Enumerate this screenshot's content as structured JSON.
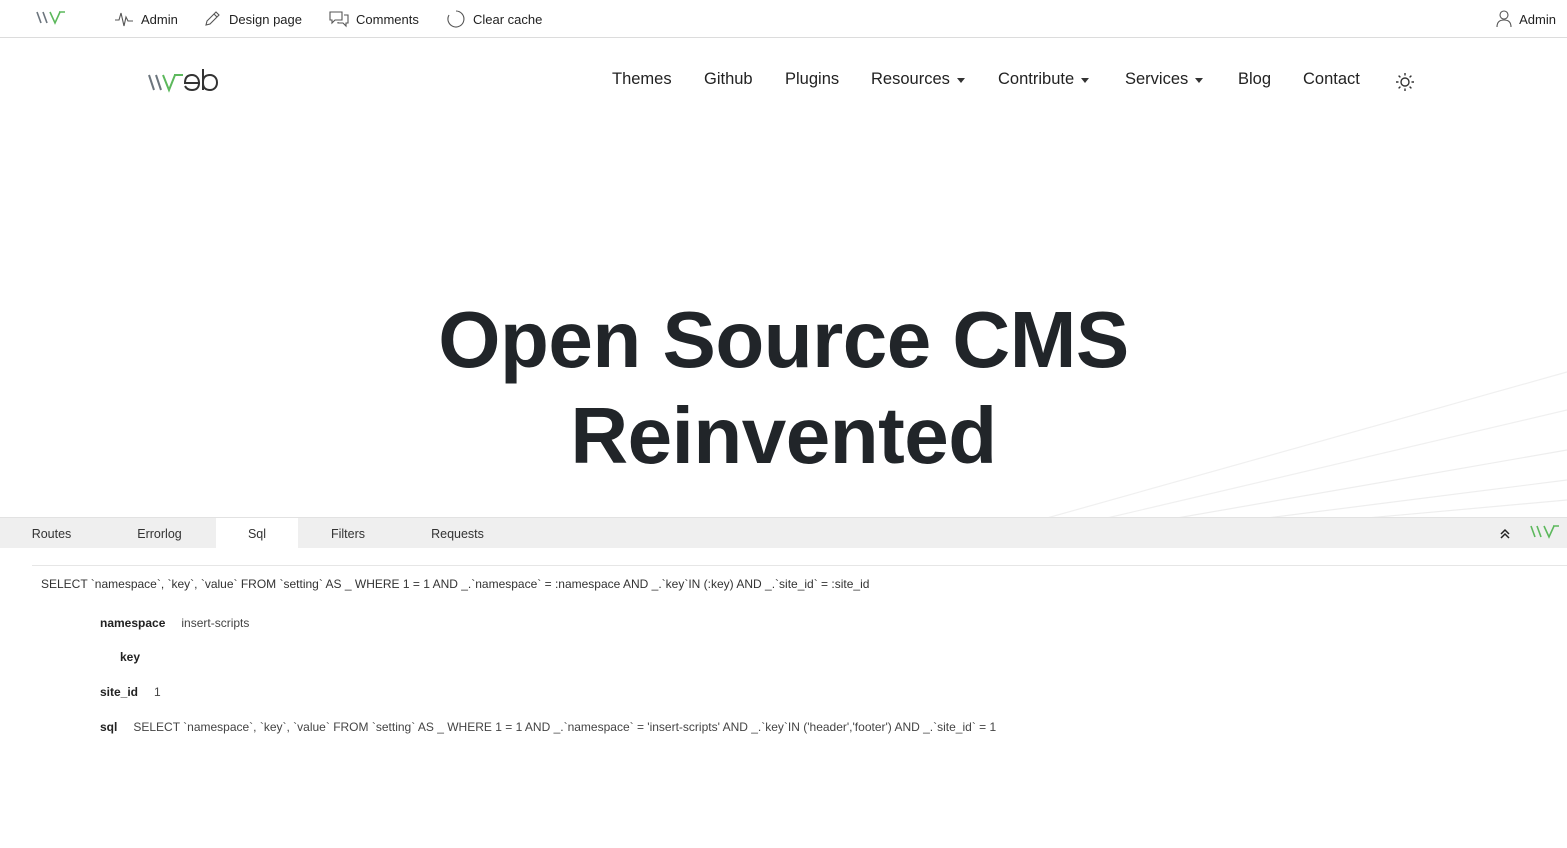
{
  "adminbar": {
    "items": [
      {
        "label": "Admin",
        "icon": "activity-icon"
      },
      {
        "label": "Design page",
        "icon": "pencil-icon"
      },
      {
        "label": "Comments",
        "icon": "comments-icon"
      },
      {
        "label": "Clear cache",
        "icon": "circle-icon"
      }
    ],
    "user_label": "Admin"
  },
  "nav": {
    "items": [
      {
        "label": "Themes"
      },
      {
        "label": "Github"
      },
      {
        "label": "Plugins"
      },
      {
        "label": "Resources",
        "dropdown": true
      },
      {
        "label": "Contribute",
        "dropdown": true
      },
      {
        "label": "Services",
        "dropdown": true
      },
      {
        "label": "Blog"
      },
      {
        "label": "Contact"
      }
    ]
  },
  "hero": {
    "line1": "Open Source CMS",
    "line2": "Reinvented"
  },
  "debug": {
    "tabs": [
      "Routes",
      "Errorlog",
      "Sql",
      "Filters",
      "Requests"
    ],
    "active_tab": "Sql",
    "query": "SELECT `namespace`, `key`, `value` FROM `setting` AS _ WHERE 1 = 1 AND _.`namespace` = :namespace AND _.`key`IN (:key) AND _.`site_id` = :site_id",
    "params": [
      {
        "key": "namespace",
        "value": "insert-scripts"
      },
      {
        "key": "key",
        "value": ""
      },
      {
        "key": "site_id",
        "value": "1"
      },
      {
        "key": "sql",
        "value": "SELECT `namespace`, `key`, `value` FROM `setting` AS _ WHERE 1 = 1 AND _.`namespace` = 'insert-scripts' AND _.`key`IN ('header','footer') AND _.`site_id` = 1"
      }
    ]
  },
  "colors": {
    "brand_green": "#5cb85c",
    "text": "#212529"
  }
}
